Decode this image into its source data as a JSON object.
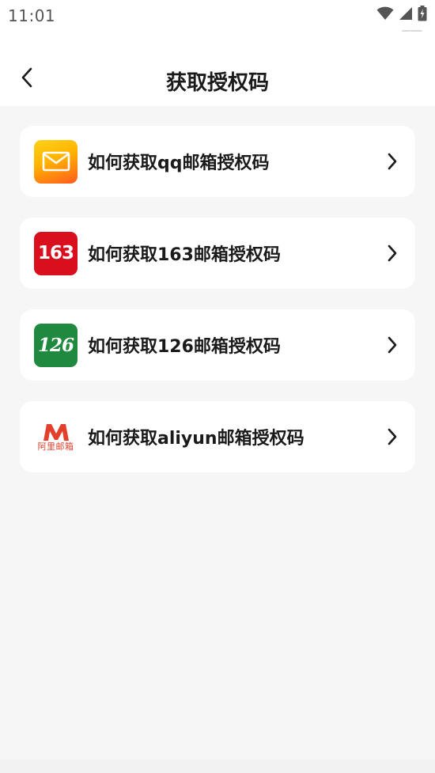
{
  "status_bar": {
    "time": "11:01",
    "icons": [
      "wifi-icon",
      "signal-icon",
      "battery-charging-icon"
    ],
    "badge": "dbc"
  },
  "header": {
    "title": "获取授权码",
    "back_icon": "chevron-left-icon"
  },
  "items": [
    {
      "label": "如何获取qq邮箱授权码",
      "logo": "qq-mail-logo"
    },
    {
      "label": "如何获取163邮箱授权码",
      "logo": "163-mail-logo",
      "logo_text": "163"
    },
    {
      "label": "如何获取126邮箱授权码",
      "logo": "126-mail-logo",
      "logo_text": "126"
    },
    {
      "label": "如何获取aliyun邮箱授权码",
      "logo": "aliyun-mail-logo",
      "logo_text": "阿里邮箱"
    }
  ],
  "colors": {
    "background": "#f6f6f6",
    "card": "#ffffff",
    "text": "#1a1a1a",
    "logo_163": "#d90f1d",
    "logo_126": "#1f8a3f",
    "logo_aliyun": "#e2402c"
  }
}
